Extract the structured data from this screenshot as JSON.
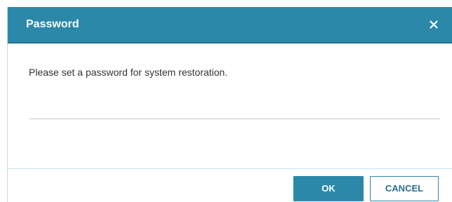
{
  "dialog": {
    "title": "Password",
    "close_icon": "close-icon",
    "message": "Please set a password for system restoration.",
    "password_value": "",
    "ok_label": "OK",
    "cancel_label": "CANCEL"
  },
  "colors": {
    "header_bg": "#2b88a8",
    "header_text": "#ffffff",
    "primary_button": "#2b88a8",
    "secondary_button_text": "#2b6f8c"
  }
}
